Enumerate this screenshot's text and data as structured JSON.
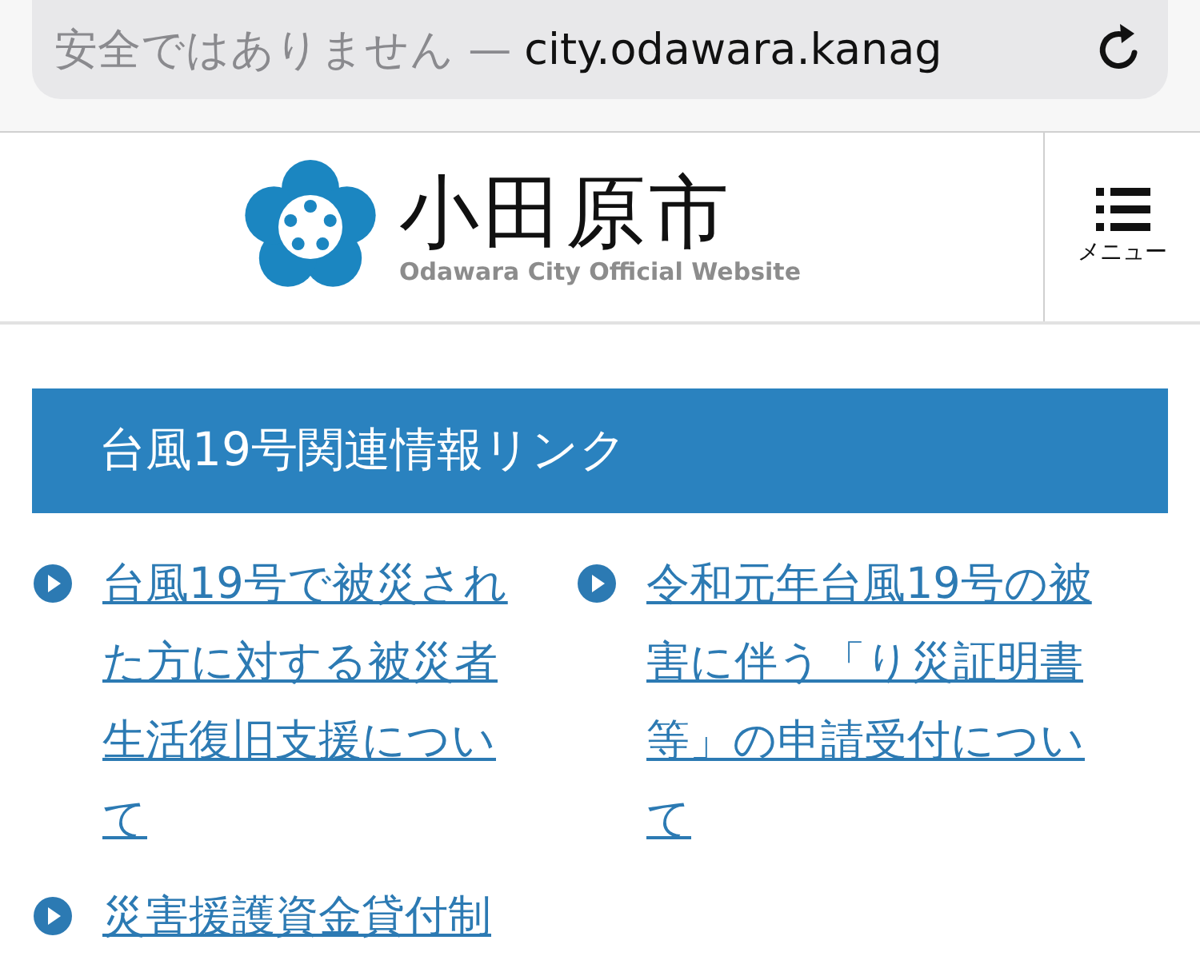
{
  "address_bar": {
    "security_label": "安全ではありません —",
    "url": "city.odawara.kanag"
  },
  "header": {
    "logo_title": "小田原市",
    "logo_subtitle": "Odawara City Official Website",
    "menu_label": "メニュー"
  },
  "section": {
    "title": "台風19号関連情報リンク",
    "links": [
      {
        "text": "台風19号で被災された方に対する被災者生活復旧支援について"
      },
      {
        "text": "令和元年台風19号の被害に伴う「り災証明書等」の申請受付について"
      },
      {
        "text": "災害援護資金貸付制"
      }
    ]
  }
}
